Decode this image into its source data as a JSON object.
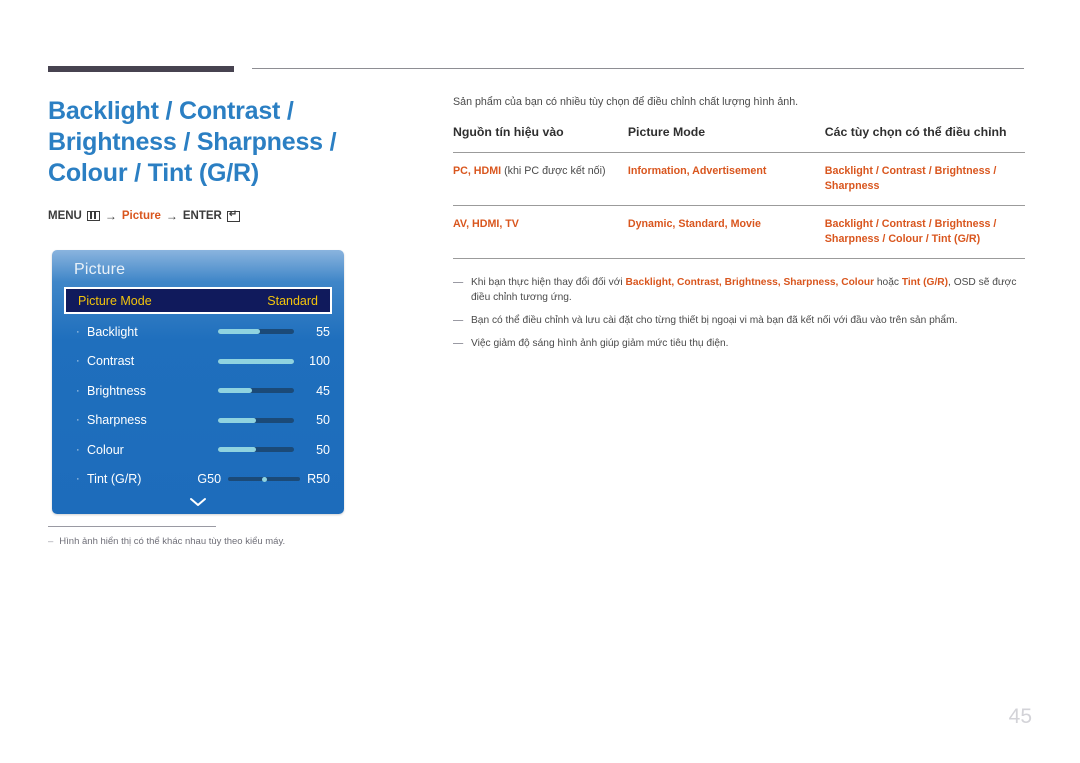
{
  "header": {
    "title": "Backlight / Contrast / Brightness / Sharpness / Colour / Tint (G/R)"
  },
  "menu_path": {
    "menu_label": "MENU",
    "menu_icon": "menu-grid-icon",
    "arrow1": "→",
    "picture_label": "Picture",
    "arrow2": "→",
    "enter_label": "ENTER",
    "enter_icon": "enter-key-icon"
  },
  "osd": {
    "title": "Picture",
    "selected": {
      "label": "Picture Mode",
      "value": "Standard"
    },
    "rows": [
      {
        "bullet": "·",
        "label": "Backlight",
        "value": "55",
        "fill_pct": 55
      },
      {
        "bullet": "·",
        "label": "Contrast",
        "value": "100",
        "fill_pct": 100
      },
      {
        "bullet": "·",
        "label": "Brightness",
        "value": "45",
        "fill_pct": 45
      },
      {
        "bullet": "·",
        "label": "Sharpness",
        "value": "50",
        "fill_pct": 50
      },
      {
        "bullet": "·",
        "label": "Colour",
        "value": "50",
        "fill_pct": 50
      }
    ],
    "tint_row": {
      "bullet": "·",
      "label": "Tint (G/R)",
      "left_end": "G50",
      "right_end": "R50"
    },
    "scroll_icon": "chevron-down-icon"
  },
  "left_footnote": {
    "dash": "–",
    "text": "Hình ảnh hiển thị có thể khác nhau tùy theo kiểu máy."
  },
  "right": {
    "intro": "Sản phẩm của bạn có nhiều tùy chọn để điều chỉnh chất lượng hình ảnh.",
    "table": {
      "headers": [
        "Nguồn tín hiệu vào",
        "Picture Mode",
        "Các tùy chọn có thể điều chỉnh"
      ],
      "rows": [
        {
          "source_main": "PC, HDMI",
          "source_note": " (khi PC được kết nối)",
          "modes": "Information, Advertisement",
          "options": "Backlight / Contrast / Brightness / Sharpness"
        },
        {
          "source_main": "AV, HDMI, TV",
          "source_note": "",
          "modes": "Dynamic, Standard, Movie",
          "options": "Backlight / Contrast / Brightness / Sharpness / Colour / Tint (G/R)"
        }
      ]
    },
    "notes": [
      {
        "dash": "—",
        "prefix": "Khi bạn thực hiện thay đổi đối với ",
        "highlights": "Backlight, Contrast, Brightness, Sharpness, Colour",
        "middle": " hoặc ",
        "highlight2": "Tint (G/R)",
        "suffix": ", OSD sẽ được điều chỉnh tương ứng."
      },
      {
        "dash": "—",
        "text": "Bạn có thể điều chỉnh và lưu cài đặt cho từng thiết bị ngoại vi mà bạn đã kết nối với đầu vào trên sản phẩm."
      },
      {
        "dash": "—",
        "text": "Việc giảm độ sáng hình ảnh giúp giảm mức tiêu thụ điện."
      }
    ]
  },
  "page_number": "45",
  "colors": {
    "title_blue": "#2b7fc3",
    "accent_orange": "#d9561e",
    "osd_blue": "#1d6cbb",
    "osd_selected_bg": "#101a5c",
    "osd_selected_text": "#f2c40c",
    "rule_dark": "#474350"
  }
}
